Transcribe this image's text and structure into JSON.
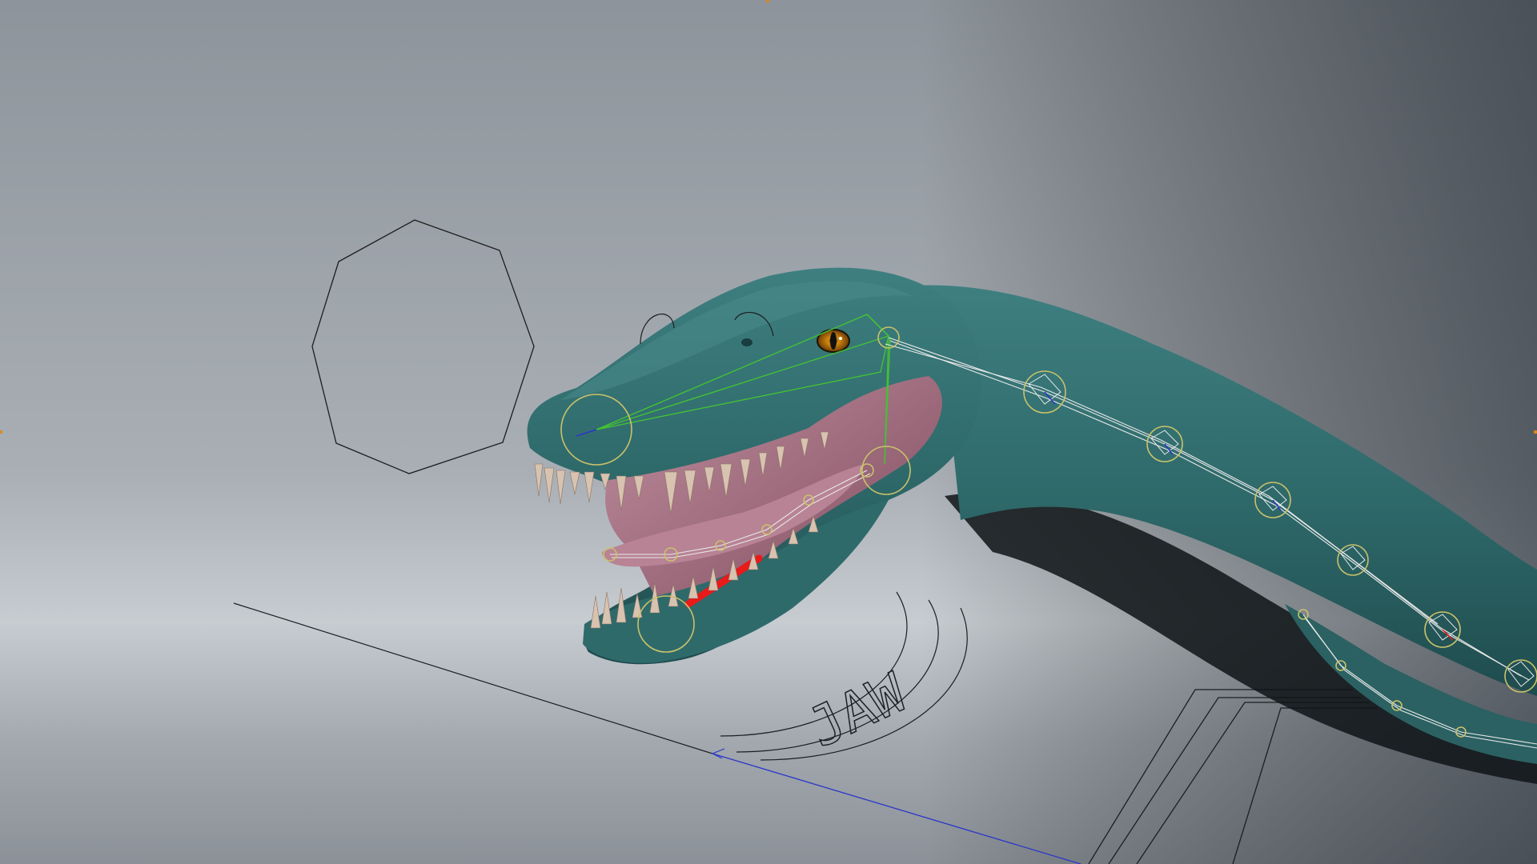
{
  "viewport": {
    "background_top": "#8e959c",
    "background_mid": "#c3c8cd",
    "background_bottom": "#8d939a",
    "background_right_dark": "#4e565f"
  },
  "creature": {
    "skin_color": "#2f6a6b",
    "skin_highlight": "#4b8a8b",
    "skin_shadow": "#163c3e",
    "mouth_color": "#a26d80",
    "tongue_color": "#b88395",
    "teeth_color": "#d8c2b0",
    "eye_color": "#d48a10"
  },
  "rig": {
    "joint_color": "#c9c26a",
    "bone_color": "#e8e8e8",
    "ik_color": "#44c234",
    "highlight_color": "#e81a1a",
    "axis_blue": "#2a36c8",
    "curve_color": "#1c1e22"
  },
  "controls": {
    "jaw_label": "JAW"
  },
  "icons": {
    "octagon": "octagon-control-icon",
    "frame_marker": "frame-marker-icon"
  }
}
